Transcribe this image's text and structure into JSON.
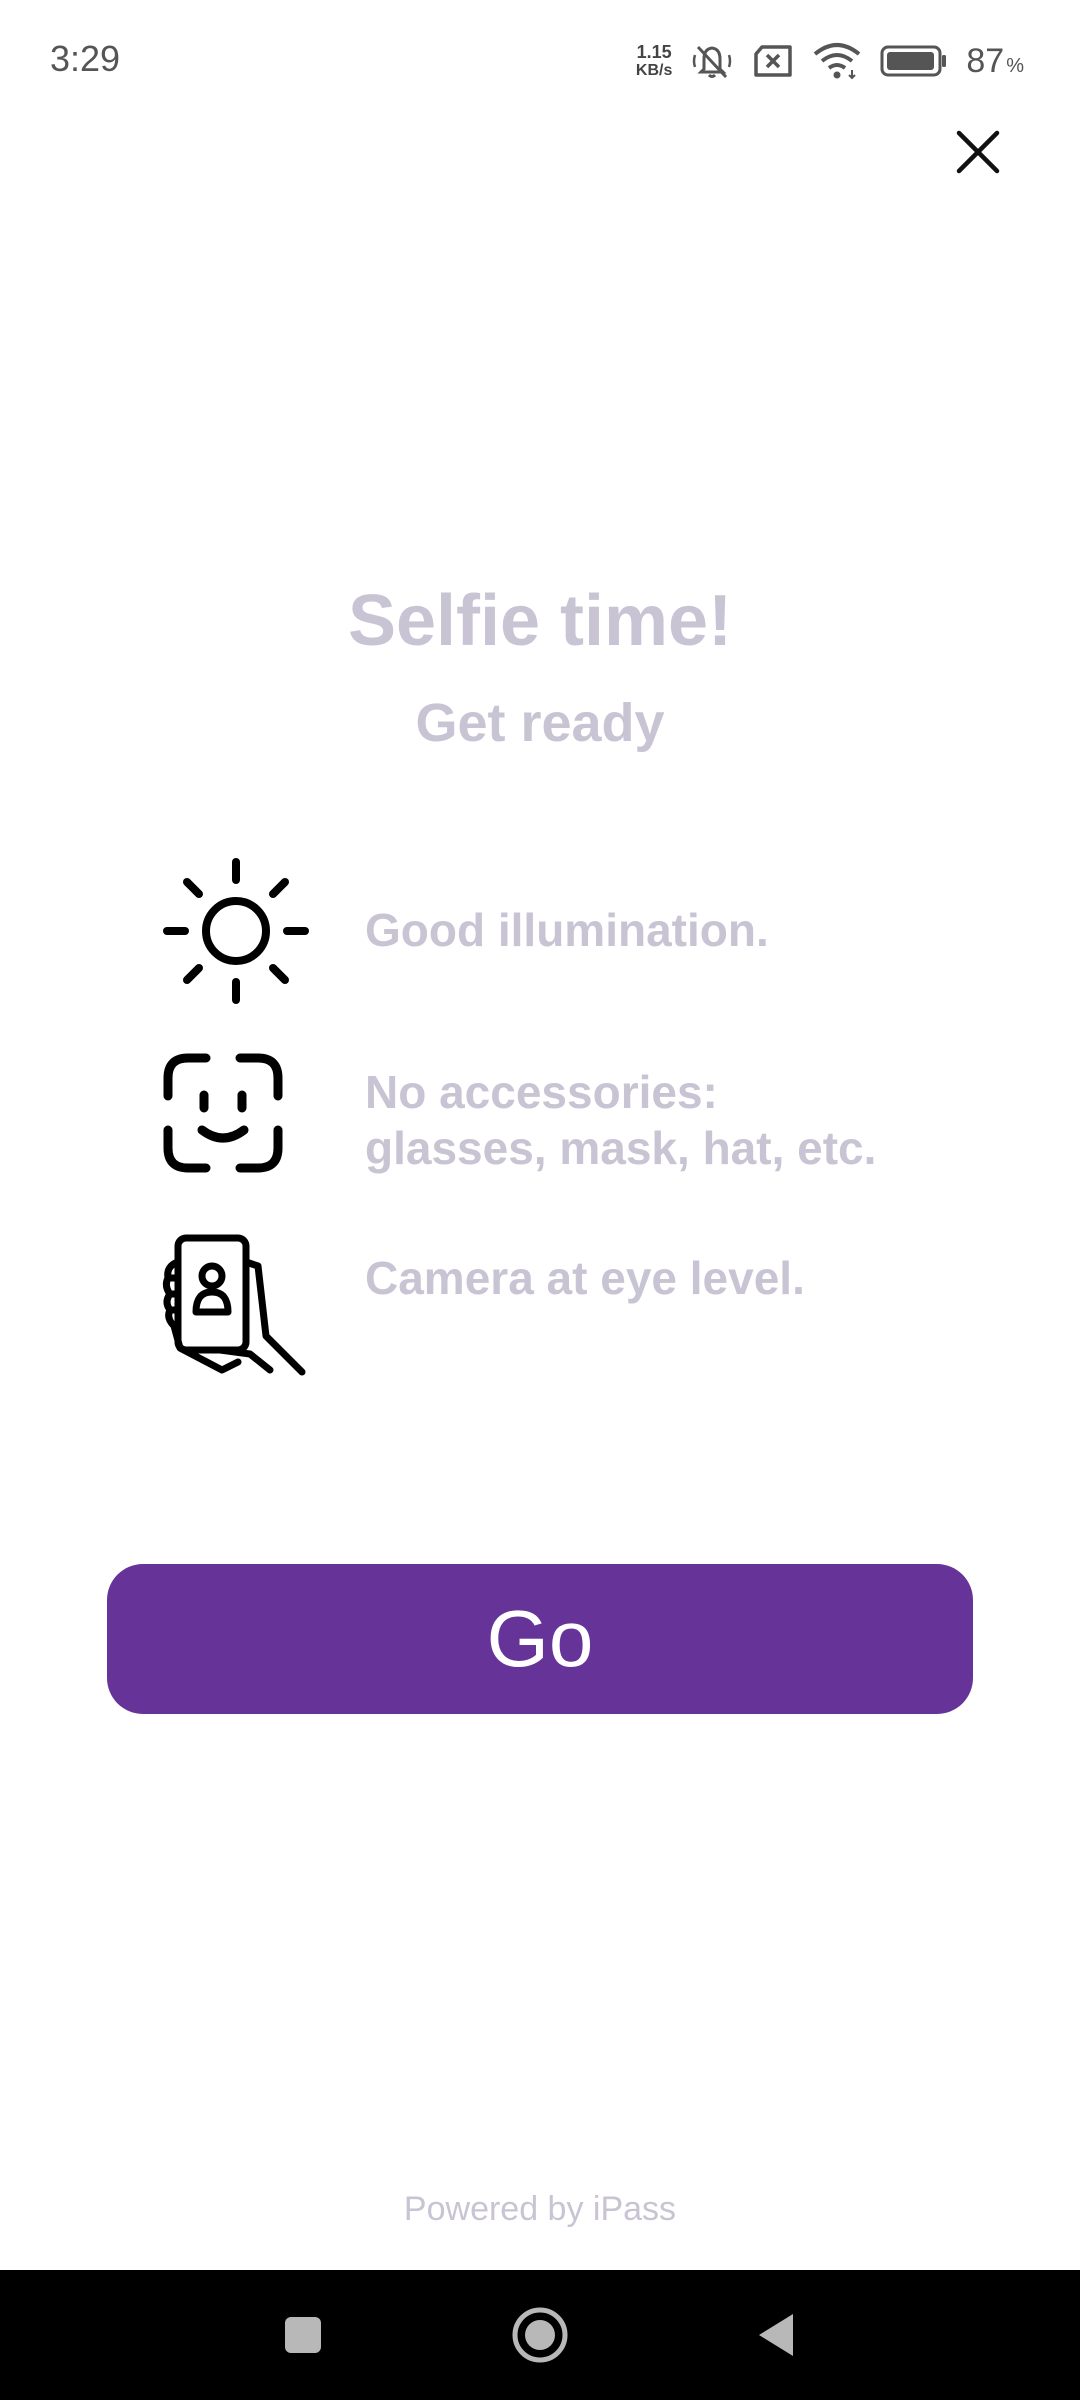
{
  "status_bar": {
    "time": "3:29",
    "net_speed_value": "1.15",
    "net_speed_unit": "KB/s",
    "battery_percent": "87",
    "battery_percent_sign": "%",
    "icons": [
      "mute-icon",
      "sim-error-icon",
      "wifi-icon",
      "battery-icon"
    ]
  },
  "header": {
    "close_icon": "close-icon"
  },
  "main": {
    "title": "Selfie time!",
    "subtitle": "Get ready",
    "tips": [
      {
        "icon": "sun-icon",
        "text": "Good illumination."
      },
      {
        "icon": "face-scan-icon",
        "text": "No accessories: glasses, mask, hat, etc."
      },
      {
        "icon": "phone-in-hand-icon",
        "text": "Camera at eye level."
      }
    ],
    "go_button_label": "Go"
  },
  "footer": {
    "powered_by": "Powered by iPass"
  },
  "nav_bar": {
    "icons": [
      "recents-icon",
      "home-icon",
      "back-icon"
    ]
  },
  "colors": {
    "accent": "#663399",
    "muted_text": "#c9c4d3",
    "icon": "#000000"
  }
}
